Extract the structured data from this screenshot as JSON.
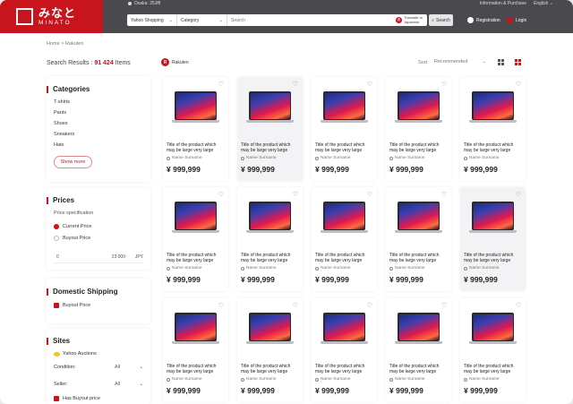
{
  "header": {
    "logo_jp": "みなと",
    "logo_en": "MINATO",
    "location": "Osaka: 25Jffl",
    "top_link": "Information & Purchase",
    "language": "English",
    "search": {
      "site": "Yahoo Shopping",
      "category": "Category",
      "placeholder": "Search",
      "translate": "Translate to Japanese",
      "button": "Search"
    },
    "registration": "Registration",
    "login": "Login"
  },
  "breadcrumb": "Home  >  Rakuten",
  "results": {
    "label": "Search Results :",
    "count": "91 424",
    "unit": "Items"
  },
  "store_filter": "Rakuten",
  "sort": {
    "label": "Sort",
    "value": "Recommended"
  },
  "sidebar": {
    "categories": {
      "title": "Categories",
      "items": [
        "T-shirts",
        "Pants",
        "Shoes",
        "Sneakers",
        "Hats"
      ],
      "show_more": "Show more"
    },
    "prices": {
      "title": "Prices",
      "subtitle": "Price specification",
      "options": [
        "Current Price",
        "Buyout Price"
      ],
      "range_from": "0",
      "range_to": "23 000",
      "currency": "JPY"
    },
    "shipping": {
      "title": "Domestic Shipping",
      "option": "Buyout Price"
    },
    "sites": {
      "title": "Sites",
      "site": "Yahoo Auctions",
      "condition_label": "Condition:",
      "condition_value": "All",
      "seller_label": "Seller:",
      "seller_value": "All",
      "buyout": "Has Buyout price"
    }
  },
  "product": {
    "title": "Title of the product which may be large very large",
    "seller": "Name Surname",
    "price": "¥ 999,999"
  },
  "colors": {
    "brand_red": "#c8141c",
    "header_gray": "#4a4a4e"
  }
}
